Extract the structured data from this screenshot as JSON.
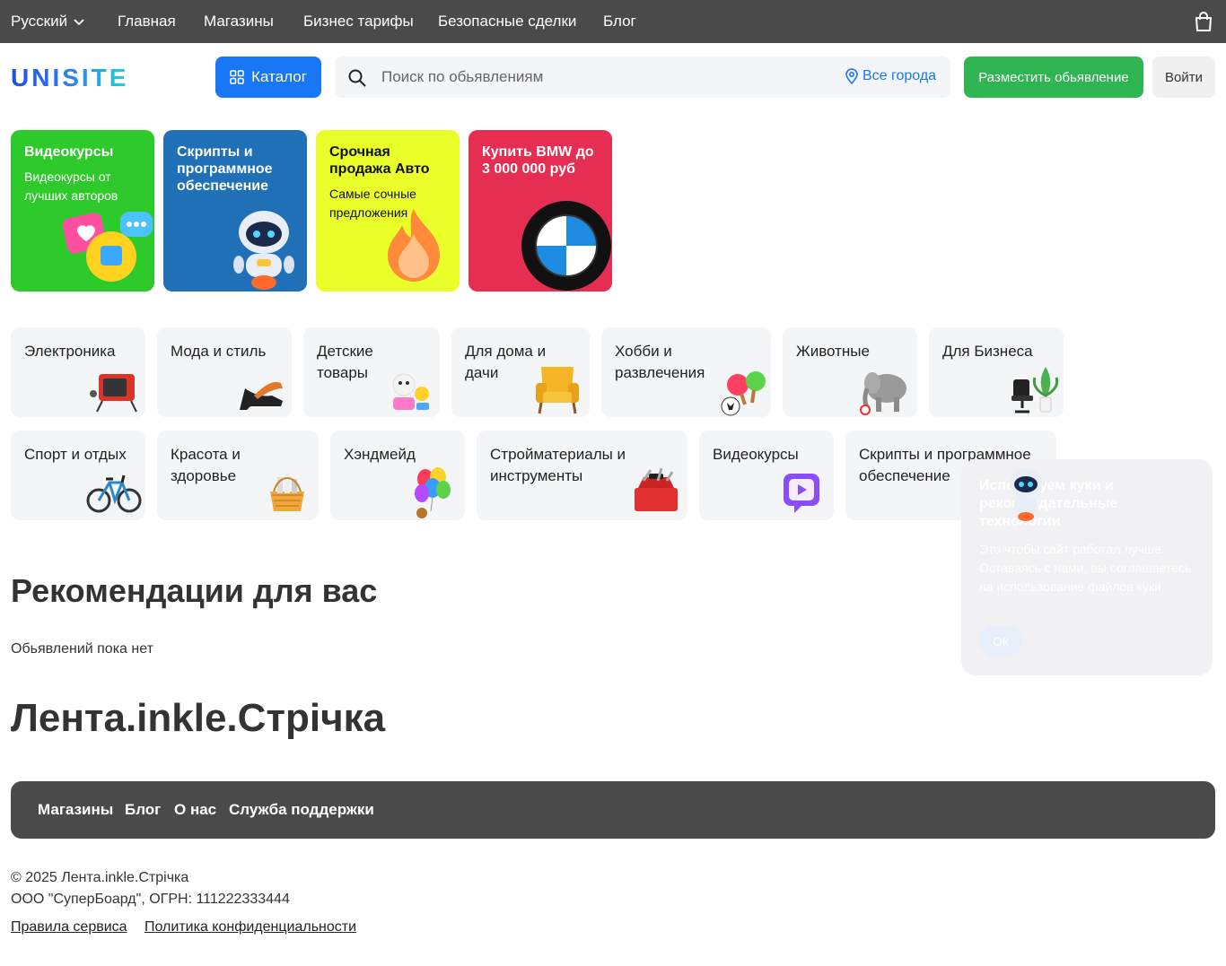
{
  "topbar": {
    "language": "Русский",
    "nav": [
      "Главная",
      "Магазины",
      "Бизнес тарифы",
      "Безопасные сделки",
      "Блог"
    ]
  },
  "header": {
    "logo": "UNISITE",
    "catalog_label": "Каталог",
    "search_placeholder": "Поиск по обьявлениям",
    "city_label": "Все города",
    "post_label": "Разместить обьявление",
    "login_label": "Войти"
  },
  "promos": [
    {
      "title": "Видеокурсы",
      "subtitle": "Видеокурсы от лучших авторов",
      "color": "#2ec92a"
    },
    {
      "title": "Скрипты и программное обеспечение",
      "subtitle": "",
      "color": "#2070b8"
    },
    {
      "title": "Срочная продажа Авто",
      "subtitle": "Самые сочные предложения",
      "color": "#eaff2a"
    },
    {
      "title": "Купить BMW до 3 000 000 руб",
      "subtitle": "",
      "color": "#e52e52"
    }
  ],
  "categories": [
    "Электроника",
    "Мода и стиль",
    "Детские товары",
    "Для дома и дачи",
    "Хобби и развлечения",
    "Животные",
    "Для Бизнеса",
    "Спорт и отдых",
    "Красота и здоровье",
    "Хэндмейд",
    "Стройматериалы и инструменты",
    "Видеокурсы",
    "Скрипты и программное обеспечение"
  ],
  "recommendations": {
    "title": "Рекомендации для вас",
    "empty": "Обьявлений пока нет"
  },
  "feed": {
    "title": "Лента.inkle.Стрічка"
  },
  "cookie": {
    "title": "Используем куки и рекомендательные технологии",
    "text": "Это чтобы сайт работал лучше. Оставаясь с нами, вы соглашаетесь на использование файлов куки.",
    "ok": "Ok"
  },
  "footer": {
    "links": [
      "Магазины",
      "Блог",
      "О нас",
      "Служба поддержки"
    ],
    "copyright": "© 2025 Лента.inkle.Стрічка",
    "company": "ООО \"СуперБоард\", ОГРН: 111222333444",
    "legal": [
      "Правила сервиса",
      "Политика конфиденциальности"
    ]
  },
  "colors": {
    "accent": "#1976f5",
    "green": "#2fb552",
    "dark": "#4a4a4a"
  }
}
